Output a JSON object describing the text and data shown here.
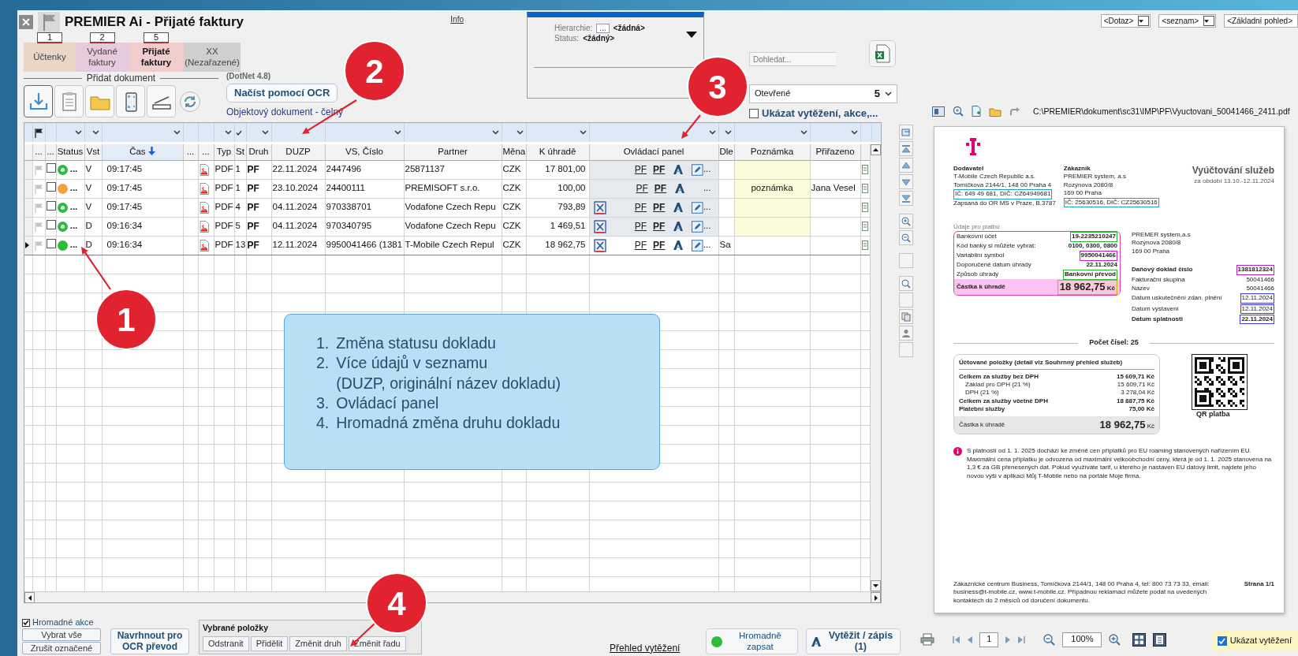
{
  "window": {
    "title": "PREMIER Ai - Přijaté faktury",
    "info_link": "Info"
  },
  "category_tabs": [
    {
      "lines": [
        "Účtenky"
      ],
      "count": "1",
      "color": "#ead6c6",
      "selected": false
    },
    {
      "lines": [
        "Vydané",
        "faktury"
      ],
      "count": "2",
      "color": "#e6cadd",
      "selected": false
    },
    {
      "lines": [
        "Přijaté",
        "faktury"
      ],
      "count": "5",
      "color": "#f0cccc",
      "selected": true
    },
    {
      "lines": [
        "XX",
        "(Nezařazené)"
      ],
      "color": "#cfcfcf",
      "selected": false
    }
  ],
  "add_document": {
    "title": "Přidat dokument",
    "dotnet_note": "(DotNet 4.8)",
    "ocr_button": "Načíst pomocí OCR",
    "object_link": "Objektový dokument - čelný"
  },
  "hierarchy_panel": {
    "hierarchy_label": "Hierarchie:",
    "hierarchy_button": "...",
    "hierarchy_value": "<žádná>",
    "status_label": "Status:",
    "status_value": "<žádný>"
  },
  "search": {
    "placeholder": "Dohledat..."
  },
  "view_selects": [
    {
      "value": "<Dotaz>",
      "arrow": true
    },
    {
      "value": "<seznam>",
      "arrow": true
    },
    {
      "value": "<Základní pohled>",
      "arrow": false
    }
  ],
  "filter_select": {
    "value": "Otevřené",
    "count": "5"
  },
  "show_extraction": {
    "label": "Ukázat vytěžení, akce,...",
    "checked": false
  },
  "grid": {
    "columns": [
      {
        "label": "...",
        "sorted": false
      },
      {
        "label": "...",
        "sorted": false
      },
      {
        "label": "Status",
        "sorted": false
      },
      {
        "label": "Vst",
        "sorted": false
      },
      {
        "label": "Čas",
        "sorted": true
      },
      {
        "label": "...",
        "sorted": false
      },
      {
        "label": "...",
        "sorted": false
      },
      {
        "label": "Typ",
        "sorted": false
      },
      {
        "label": "St",
        "sorted": false
      },
      {
        "label": "Druh",
        "sorted": false
      },
      {
        "label": "DUZP",
        "sorted": false
      },
      {
        "label": "VS, Číslo",
        "sorted": false
      },
      {
        "label": "Partner",
        "sorted": false
      },
      {
        "label": "Měna",
        "sorted": false
      },
      {
        "label": "K úhradě",
        "sorted": false
      },
      {
        "label": "Ovládací panel",
        "sorted": false
      },
      {
        "label": "Dle",
        "sorted": false
      },
      {
        "label": "Poznámka",
        "sorted": false
      },
      {
        "label": "Přiřazeno",
        "sorted": false
      }
    ],
    "rows": [
      {
        "selected": false,
        "checked": false,
        "kind": "ring",
        "color": "#2dbb3c",
        "status_menu": "...",
        "entry": "V",
        "time": "09:17:45",
        "type": "PDF",
        "st": "1",
        "druh": "PF",
        "duzp": "22.11.2024",
        "vs": "2447496",
        "partner": "25871137",
        "currency": "CZK",
        "amount": "17 801,00",
        "excel": false,
        "links": [
          "PF",
          "PF"
        ],
        "edit": true,
        "more": "..."
      },
      {
        "selected": false,
        "checked": false,
        "kind": "filled",
        "color": "#f4a23c",
        "status_menu": "...",
        "entry": "V",
        "time": "09:17:45",
        "type": "PDF",
        "st": "1",
        "druh": "PF",
        "duzp": "23.10.2024",
        "vs": "24400111",
        "partner": "PREMISOFT s.r.o.",
        "currency": "CZK",
        "amount": "100,00",
        "excel": false,
        "links": [
          "PF",
          "PF"
        ],
        "edit": false,
        "more": "...",
        "note": "poznámka",
        "assigned": "Jana Vesel"
      },
      {
        "selected": false,
        "checked": false,
        "kind": "ring",
        "color": "#2dbb3c",
        "status_menu": "...",
        "entry": "V",
        "time": "09:17:45",
        "type": "PDF",
        "st": "4",
        "druh": "PF",
        "duzp": "04.11.2024",
        "vs": "970338701",
        "partner": "Vodafone Czech Repu",
        "currency": "CZK",
        "amount": "793,89",
        "excel": true,
        "links": [
          "PF",
          "PF"
        ],
        "edit": true,
        "more": "..."
      },
      {
        "selected": false,
        "checked": false,
        "kind": "ring",
        "color": "#2dbb3c",
        "status_menu": "...",
        "entry": "D",
        "time": "09:16:34",
        "type": "PDF",
        "st": "5",
        "druh": "PF",
        "duzp": "04.11.2024",
        "vs": "970340795",
        "partner": "Vodafone Czech Repu",
        "currency": "CZK",
        "amount": "1 469,51",
        "excel": true,
        "links": [
          "PF",
          "PF"
        ],
        "edit": true,
        "more": "..."
      },
      {
        "selected": true,
        "checked": false,
        "kind": "filled",
        "color": "#2dbb3c",
        "status_menu": "...",
        "entry": "D",
        "time": "09:16:34",
        "type": "PDF",
        "st": "13",
        "druh": "PF",
        "duzp": "12.11.2024",
        "vs": "9950041466 (1381",
        "partner": "T-Mobile Czech Repul",
        "currency": "CZK",
        "amount": "18 962,75",
        "excel": true,
        "links": [
          "PF",
          "PF"
        ],
        "edit": true,
        "more": "...",
        "dle": "Sa"
      }
    ]
  },
  "callout": {
    "items": [
      {
        "number": "1.",
        "lines": [
          "Změna statusu dokladu"
        ]
      },
      {
        "number": "2.",
        "lines": [
          "Více údajů v seznamu",
          "(DUZP, originální název dokladu)"
        ]
      },
      {
        "number": "3.",
        "lines": [
          "Ovládací panel"
        ]
      },
      {
        "number": "4.",
        "lines": [
          "Hromadná změna druhu dokladu"
        ]
      }
    ]
  },
  "markers": [
    {
      "number": "1"
    },
    {
      "number": "2"
    },
    {
      "number": "3"
    },
    {
      "number": "4"
    }
  ],
  "bottom_bar": {
    "mass_actions": {
      "label": "Hromadné akce",
      "checked": true
    },
    "select_all": "Vybrat vše",
    "clear_selected": "Zrušit označené",
    "ocr_suggest_lines": [
      "Navrhnout pro",
      "OCR převod"
    ],
    "selected_items": {
      "title": "Vybrané položky",
      "buttons": [
        "Odstranit",
        "Přidělit",
        "Změnit druh",
        "Změnit řadu"
      ]
    },
    "overview_link": "Přehled vytěžení",
    "mass_write_lines": [
      "Hromadně",
      "zapsat"
    ],
    "extract_lines": [
      "Vytěžit / zápis",
      "(1)"
    ]
  },
  "preview": {
    "path": "C:\\PREMIER\\dokument\\sc31\\IMP\\PF\\Vyuctovani_50041466_2411.pdf",
    "page": "1",
    "zoom": "100%",
    "show_extraction": {
      "label": "Ukázat vytěžení",
      "checked": true
    },
    "document": {
      "title": "Vyúčtování služeb",
      "period": "za období 13.10.-12.11.2024",
      "supplier": {
        "heading": "Dodavatel",
        "lines": [
          {
            "text": "T-Mobile Czech Republic a.s."
          },
          {
            "text": "Tomíčkova 2144/1, 148 00 Praha 4"
          },
          {
            "text": "IČ: 649 49 681, DIČ: CZ64949681",
            "color": "#1aa3c4"
          },
          {
            "text": "Zapsaná do OR MS v Praze, B.3787"
          }
        ]
      },
      "customer": {
        "heading": "Zákazník",
        "lines": [
          {
            "text": "PREMIER system, a.s"
          },
          {
            "text": "Rozýnova 2080/8"
          },
          {
            "text": "169 00 Praha"
          },
          {
            "text": "IČ: 25630516, DIČ: CZ25630516",
            "color": "#1aa3c4"
          }
        ]
      },
      "payment": {
        "heading": "Údaje pro platbu",
        "rows": [
          {
            "label": "Bankovní účet",
            "value": "19-2235210247",
            "color": "#2fb52f"
          },
          {
            "label": "Kód banky si můžete vybrat:",
            "value": "0100, 0300, 0800"
          },
          {
            "label": "Variabilní symbol",
            "value": "9950041466",
            "color": "#c21cc2"
          },
          {
            "label": "Doporučené datum úhrady",
            "value": "22.11.2024"
          },
          {
            "label": "Způsob úhrady",
            "value": "Bankovní převod",
            "color": "#2fb52f"
          }
        ],
        "total": {
          "label": "Částka k úhradě",
          "value": "18 962,75",
          "currency": "Kč",
          "color": "#c8b400"
        }
      },
      "address": [
        "PREMER system,a.s",
        "Rozýnova 2080/8",
        "169 00  Praha"
      ],
      "tax_rows": [
        {
          "label": "Daňový doklad číslo",
          "value": "1381812324",
          "color": "#c21cc2",
          "kind": "bold"
        },
        {
          "label": "Fakturační skupina",
          "value": "50041466",
          "kind": "plain"
        },
        {
          "label": "Název",
          "value": "50041466",
          "kind": "plain"
        },
        {
          "label": "Datum uskutečnění zdan. plnění",
          "value": "12.11.2024",
          "color": "#3a3aff",
          "kind": "plain"
        },
        {
          "label": "Datum vystavení",
          "value": "12.11.2024",
          "color": "#3a3aff",
          "kind": "plain"
        },
        {
          "label": "Datum splatnosti",
          "value": "22.11.2024",
          "color": "#3a3aff",
          "kind": "bold"
        }
      ],
      "count_label": "Počet čísel: 25",
      "summary": {
        "title": "Účtované položky (detail viz Souhrnný přehled služeb)",
        "rows": [
          {
            "label": "Celkem za služby bez DPH",
            "value": "15 609,71 Kč",
            "kind": "bold"
          },
          {
            "label": "Základ pro DPH (21 %)",
            "value": "15 609,71 Kč",
            "kind": "indent"
          },
          {
            "label": "DPH (21 %)",
            "value": "3 278,04 Kč",
            "kind": "indent"
          },
          {
            "label": "Celkem za služby včetně DPH",
            "value": "18 887,75 Kč",
            "kind": "bold"
          },
          {
            "label": "Platební služby",
            "value": "75,00 Kč",
            "kind": "bold"
          }
        ],
        "total_label": "Částka k úhradě",
        "total_value": "18 962,75",
        "total_currency": "Kč"
      },
      "qr_label": "QR platba",
      "notice": "S platností od 1. 1. 2025 dochází ke změně cen příplatků pro EU roaming stanovených nařízením EU. Maximální cena příplatku je odvozena od maximální velkoobchodní ceny, která je od 1. 1. 2025 stanovena na 1,3 € za GB přenesených dat. Pokud využíváte tarif, u kterého je nastaven EU datový limit, najdete jeho novou výši v aplikaci Můj T-Mobile nebo na portále Moje firma.",
      "footer": "Zákaznické centrum Business, Tomíčkova 2144/1, 148 00 Praha 4, tel: 800 73 73 33, email: business@t-mobile.cz, www.t-mobile.cz. Případnou reklamaci můžete podat na uvedených kontaktech do 2 měsíců od doručení dokumentu.",
      "page_label": "Strana 1/1"
    }
  }
}
